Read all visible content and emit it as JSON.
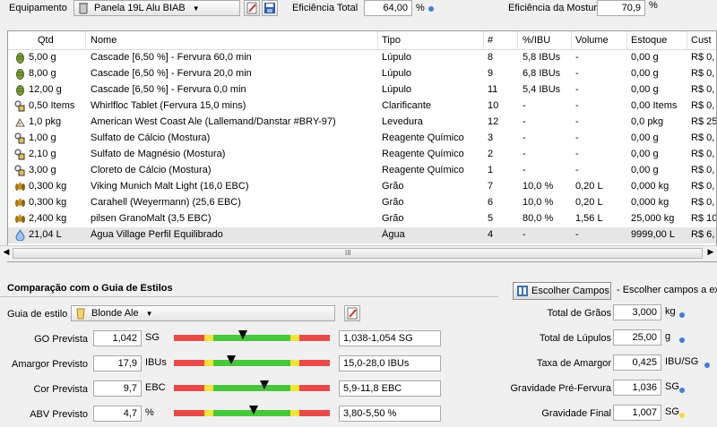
{
  "top": {
    "equipment_label": "Equipamento",
    "equipment_value": "Panela 19L Alu BIAB",
    "efficiency_total_label": "Eficiência Total",
    "efficiency_total_value": "64,00",
    "efficiency_total_unit": "%",
    "efficiency_mash_label": "Eficiência da Mostura",
    "efficiency_mash_value": "70,9",
    "efficiency_mash_unit": "%"
  },
  "grid": {
    "headers": [
      "Qtd",
      "Nome",
      "Tipo",
      "#",
      "%/IBU",
      "Volume",
      "Estoque",
      "Cust"
    ],
    "rows": [
      {
        "icon": "hop",
        "qty": "5,00 g",
        "name": "Cascade [6,50 %] - Fervura 60,0 min",
        "type": "Lúpulo",
        "num": "8",
        "pct": "5,8 IBUs",
        "vol": "-",
        "stock": "0,00 g",
        "cost": "R$ 0,"
      },
      {
        "icon": "hop",
        "qty": "8,00 g",
        "name": "Cascade [6,50 %] - Fervura 20,0 min",
        "type": "Lúpulo",
        "num": "9",
        "pct": "6,8 IBUs",
        "vol": "-",
        "stock": "0,00 g",
        "cost": "R$ 0,"
      },
      {
        "icon": "hop",
        "qty": "12,00 g",
        "name": "Cascade [6,50 %] - Fervura 0,0 min",
        "type": "Lúpulo",
        "num": "11",
        "pct": "5,4 IBUs",
        "vol": "-",
        "stock": "0,00 g",
        "cost": "R$ 0,"
      },
      {
        "icon": "misc",
        "qty": "0,50 Items",
        "name": "Whirlfloc Tablet (Fervura 15,0 mins)",
        "type": "Clarificante",
        "num": "10",
        "pct": "-",
        "vol": "-",
        "stock": "0,00 Items",
        "cost": "R$ 0,"
      },
      {
        "icon": "yeast",
        "qty": "1,0 pkg",
        "name": "American West Coast Ale (Lallemand/Danstar #BRY-97)",
        "type": "Levedura",
        "num": "12",
        "pct": "-",
        "vol": "-",
        "stock": "0,0 pkg",
        "cost": "R$ 25"
      },
      {
        "icon": "misc",
        "qty": "1,00 g",
        "name": "Sulfato de Cálcio (Mostura)",
        "type": "Reagente Químico",
        "num": "3",
        "pct": "-",
        "vol": "-",
        "stock": "0,00 g",
        "cost": "R$ 0,"
      },
      {
        "icon": "misc",
        "qty": "2,10 g",
        "name": "Sulfato de Magnésio (Mostura)",
        "type": "Reagente Químico",
        "num": "2",
        "pct": "-",
        "vol": "-",
        "stock": "0,00 g",
        "cost": "R$ 0,"
      },
      {
        "icon": "misc",
        "qty": "3,00 g",
        "name": "Cloreto de Cálcio (Mostura)",
        "type": "Reagente Químico",
        "num": "1",
        "pct": "-",
        "vol": "-",
        "stock": "0,00 g",
        "cost": "R$ 0,"
      },
      {
        "icon": "grain",
        "qty": "0,300 kg",
        "name": "Viking Munich Malt Light (16,0 EBC)",
        "type": "Grão",
        "num": "7",
        "pct": "10,0 %",
        "vol": "0,20 L",
        "stock": "0,000 kg",
        "cost": "R$ 0,"
      },
      {
        "icon": "grain",
        "qty": "0,300 kg",
        "name": "Carahell (Weyermann) (25,6 EBC)",
        "type": "Grão",
        "num": "6",
        "pct": "10,0 %",
        "vol": "0,20 L",
        "stock": "0,000 kg",
        "cost": "R$ 0,"
      },
      {
        "icon": "grain",
        "qty": "2,400 kg",
        "name": "pilsen GranoMalt (3,5 EBC)",
        "type": "Grão",
        "num": "5",
        "pct": "80,0 %",
        "vol": "1,56 L",
        "stock": "25,000 kg",
        "cost": "R$ 10"
      },
      {
        "icon": "water",
        "qty": "21,04 L",
        "name": "Água Village Perfil Equilibrado",
        "type": "Água",
        "num": "4",
        "pct": "-",
        "vol": "-",
        "stock": "9999,00 L",
        "cost": "R$ 6,"
      }
    ],
    "scroll_grip": "III"
  },
  "style": {
    "section_title": "Comparação com o Guia de Estilos",
    "guide_label": "Guia de estilo",
    "guide_value": "Blonde Ale",
    "rows": [
      {
        "label": "GO Prevista",
        "value": "1,042",
        "unit": "SG",
        "range": "1,038-1,054 SG",
        "marker": 0.44
      },
      {
        "label": "Amargor Previsto",
        "value": "17,9",
        "unit": "IBUs",
        "range": "15,0-28,0 IBUs",
        "marker": 0.37
      },
      {
        "label": "Cor Prevista",
        "value": "9,7",
        "unit": "EBC",
        "range": "5,9-11,8 EBC",
        "marker": 0.58
      },
      {
        "label": "ABV Previsto",
        "value": "4,7",
        "unit": "%",
        "range": "3,80-5,50 %",
        "marker": 0.51
      }
    ]
  },
  "fields": {
    "choose_button": "Escolher Campos",
    "choose_hint": "- Escolher campos a ex",
    "rows": [
      {
        "label": "Total de Grãos",
        "value": "3,000",
        "unit": "kg",
        "dot": "blue"
      },
      {
        "label": "Total de Lúpulos",
        "value": "25,00",
        "unit": "g",
        "dot": "blue"
      },
      {
        "label": "Taxa de Amargor",
        "value": "0,425",
        "unit": "IBU/SG",
        "dot": "blue"
      },
      {
        "label": "Gravidade Pré-Fervura",
        "value": "1,036",
        "unit": "SG",
        "dot": "blue"
      },
      {
        "label": "Gravidade Final",
        "value": "1,007",
        "unit": "SG",
        "dot": "yellow"
      }
    ]
  },
  "colors": {
    "bar_red": "#e84a4a",
    "bar_yellow": "#f3e33a",
    "bar_green": "#47c73c",
    "dot_blue": "#3f7fd9",
    "dot_yellow": "#f2d93b"
  }
}
